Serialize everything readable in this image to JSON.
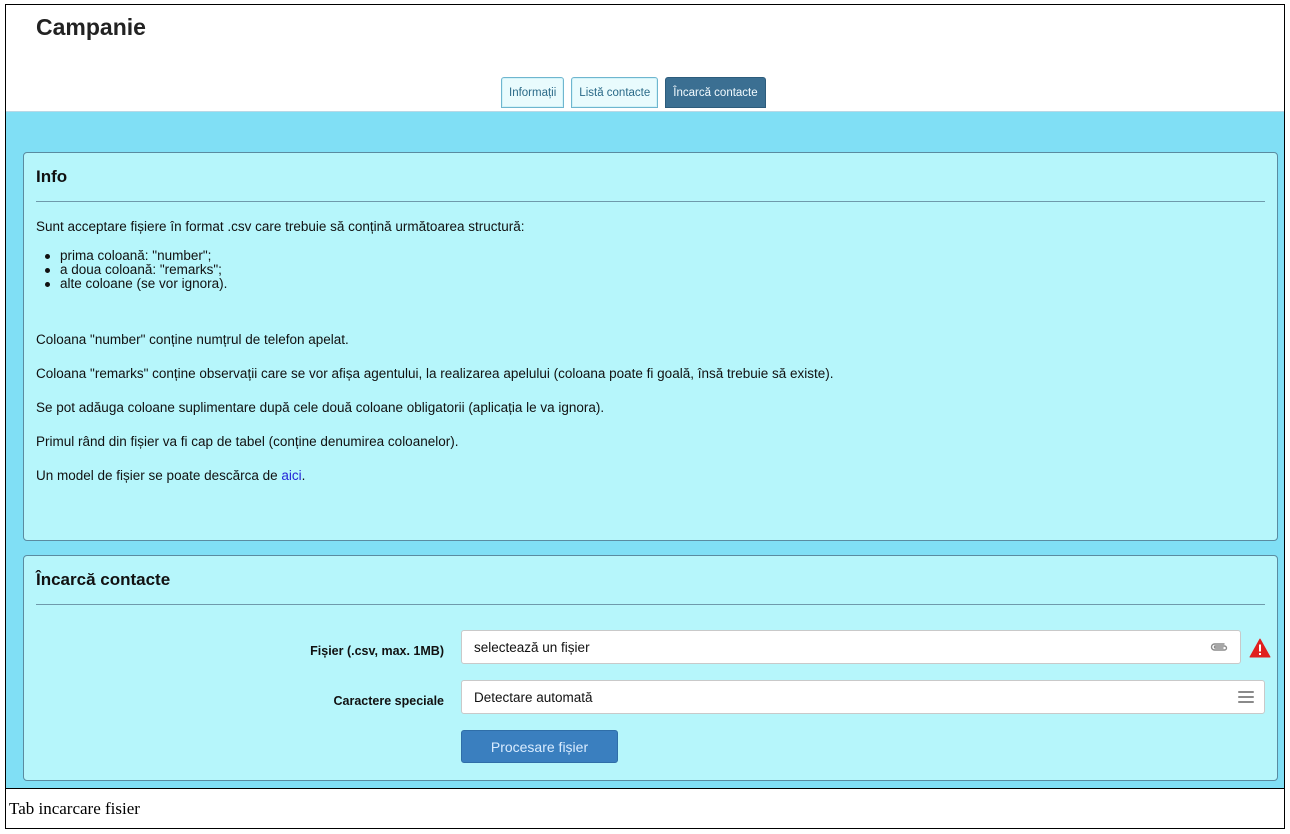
{
  "page": {
    "title": "Campanie"
  },
  "tabs": [
    {
      "label": "Informații",
      "active": false
    },
    {
      "label": "Listă contacte",
      "active": false
    },
    {
      "label": "Încarcă contacte",
      "active": true
    }
  ],
  "info_panel": {
    "title": "Info",
    "intro": "Sunt acceptare fișiere în format .csv care trebuie să conțină următoarea structură:",
    "list": [
      "prima coloană: \"number\";",
      "a doua coloană: \"remarks\";",
      "alte coloane (se vor ignora)."
    ],
    "p_number": "Coloana \"number\" conține numțrul de telefon apelat.",
    "p_remarks": "Coloana \"remarks\" conține observații care se vor afișa agentului, la realizarea apelului (coloana poate fi goală, însă trebuie să existe).",
    "p_extra": "Se pot adăuga coloane suplimentare după cele două coloane obligatorii (aplicația le va ignora).",
    "p_header": "Primul rând din fișier va fi cap de tabel (conține denumirea coloanelor).",
    "p_model_prefix": "Un model de fișier se poate descărca de ",
    "p_model_link": "aici",
    "p_model_suffix": "."
  },
  "upload_panel": {
    "title": "Încarcă contacte",
    "file_label": "Fișier (.csv, max. 1MB)",
    "file_value": "selectează un fișier",
    "encoding_label": "Caractere speciale",
    "encoding_value": "Detectare automată",
    "submit_label": "Procesare fișier"
  },
  "caption": "Tab incarcare fisier",
  "colors": {
    "content_bg": "#80dff5",
    "panel_bg": "#b6f6fb",
    "active_tab": "#3b6f92",
    "button": "#3a7fbf",
    "warning": "#e02020",
    "link": "#2525d8"
  },
  "icons": {
    "file_field": "paperclip-icon",
    "file_warning": "warning-icon",
    "encoding_field": "menu-icon"
  }
}
